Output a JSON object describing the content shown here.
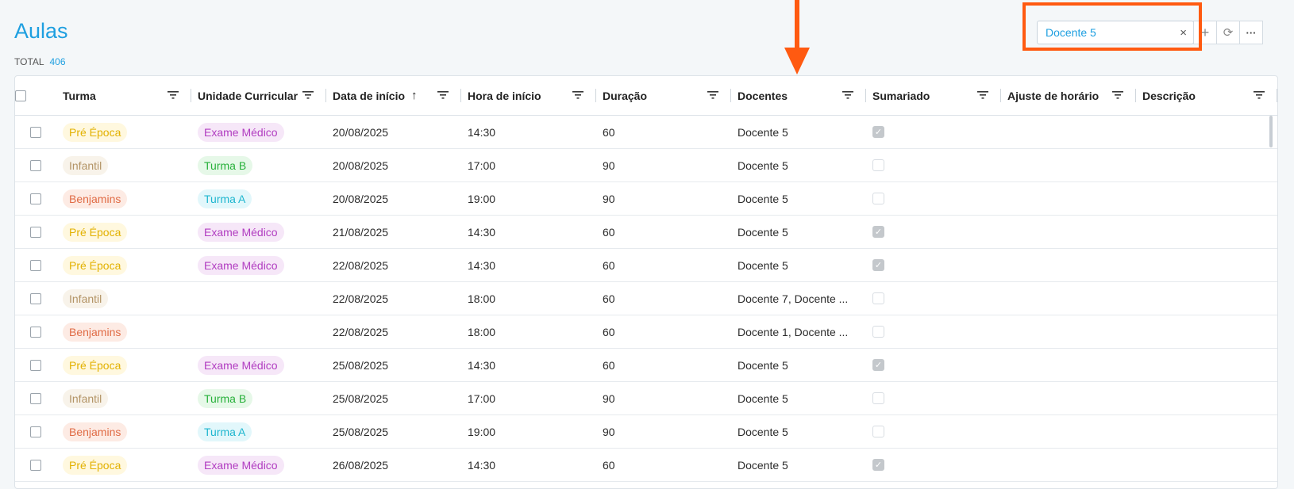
{
  "page": {
    "title": "Aulas",
    "total_label": "TOTAL",
    "total_count": "406"
  },
  "search": {
    "value": "Docente 5",
    "clear_icon": "×"
  },
  "toolbar": {
    "add_icon": "+",
    "refresh_icon": "⟳",
    "more_icon": "···"
  },
  "columns": {
    "turma": "Turma",
    "uc": "Unidade Curricular",
    "date": "Data de início",
    "time": "Hora de início",
    "dur": "Duração",
    "doc": "Docentes",
    "sum": "Sumariado",
    "ajuste": "Ajuste de horário",
    "desc": "Descrição",
    "sort_icon": "↑"
  },
  "colors": {
    "Pré Época": {
      "bg": "#fff8df",
      "fg": "#e2b100"
    },
    "Infantil": {
      "bg": "#f8f3ea",
      "fg": "#b39466"
    },
    "Benjamins": {
      "bg": "#fdebe4",
      "fg": "#e06b45"
    },
    "Exame Médico": {
      "bg": "#f6e7f8",
      "fg": "#b13dc1"
    },
    "Turma B": {
      "bg": "#e6f8e8",
      "fg": "#27b03a"
    },
    "Turma A": {
      "bg": "#e2f7fb",
      "fg": "#1eb6cf"
    }
  },
  "rows": [
    {
      "turma": "Pré Época",
      "uc": "Exame Médico",
      "date": "20/08/2025",
      "time": "14:30",
      "dur": "60",
      "doc": "Docente 5",
      "sum": true
    },
    {
      "turma": "Infantil",
      "uc": "Turma B",
      "date": "20/08/2025",
      "time": "17:00",
      "dur": "90",
      "doc": "Docente 5",
      "sum": false
    },
    {
      "turma": "Benjamins",
      "uc": "Turma A",
      "date": "20/08/2025",
      "time": "19:00",
      "dur": "90",
      "doc": "Docente 5",
      "sum": false
    },
    {
      "turma": "Pré Época",
      "uc": "Exame Médico",
      "date": "21/08/2025",
      "time": "14:30",
      "dur": "60",
      "doc": "Docente 5",
      "sum": true
    },
    {
      "turma": "Pré Época",
      "uc": "Exame Médico",
      "date": "22/08/2025",
      "time": "14:30",
      "dur": "60",
      "doc": "Docente 5",
      "sum": true
    },
    {
      "turma": "Infantil",
      "uc": "",
      "date": "22/08/2025",
      "time": "18:00",
      "dur": "60",
      "doc": "Docente 7, Docente ...",
      "sum": false
    },
    {
      "turma": "Benjamins",
      "uc": "",
      "date": "22/08/2025",
      "time": "18:00",
      "dur": "60",
      "doc": "Docente 1, Docente ...",
      "sum": false
    },
    {
      "turma": "Pré Época",
      "uc": "Exame Médico",
      "date": "25/08/2025",
      "time": "14:30",
      "dur": "60",
      "doc": "Docente 5",
      "sum": true
    },
    {
      "turma": "Infantil",
      "uc": "Turma B",
      "date": "25/08/2025",
      "time": "17:00",
      "dur": "90",
      "doc": "Docente 5",
      "sum": false
    },
    {
      "turma": "Benjamins",
      "uc": "Turma A",
      "date": "25/08/2025",
      "time": "19:00",
      "dur": "90",
      "doc": "Docente 5",
      "sum": false
    },
    {
      "turma": "Pré Época",
      "uc": "Exame Médico",
      "date": "26/08/2025",
      "time": "14:30",
      "dur": "60",
      "doc": "Docente 5",
      "sum": true
    }
  ]
}
